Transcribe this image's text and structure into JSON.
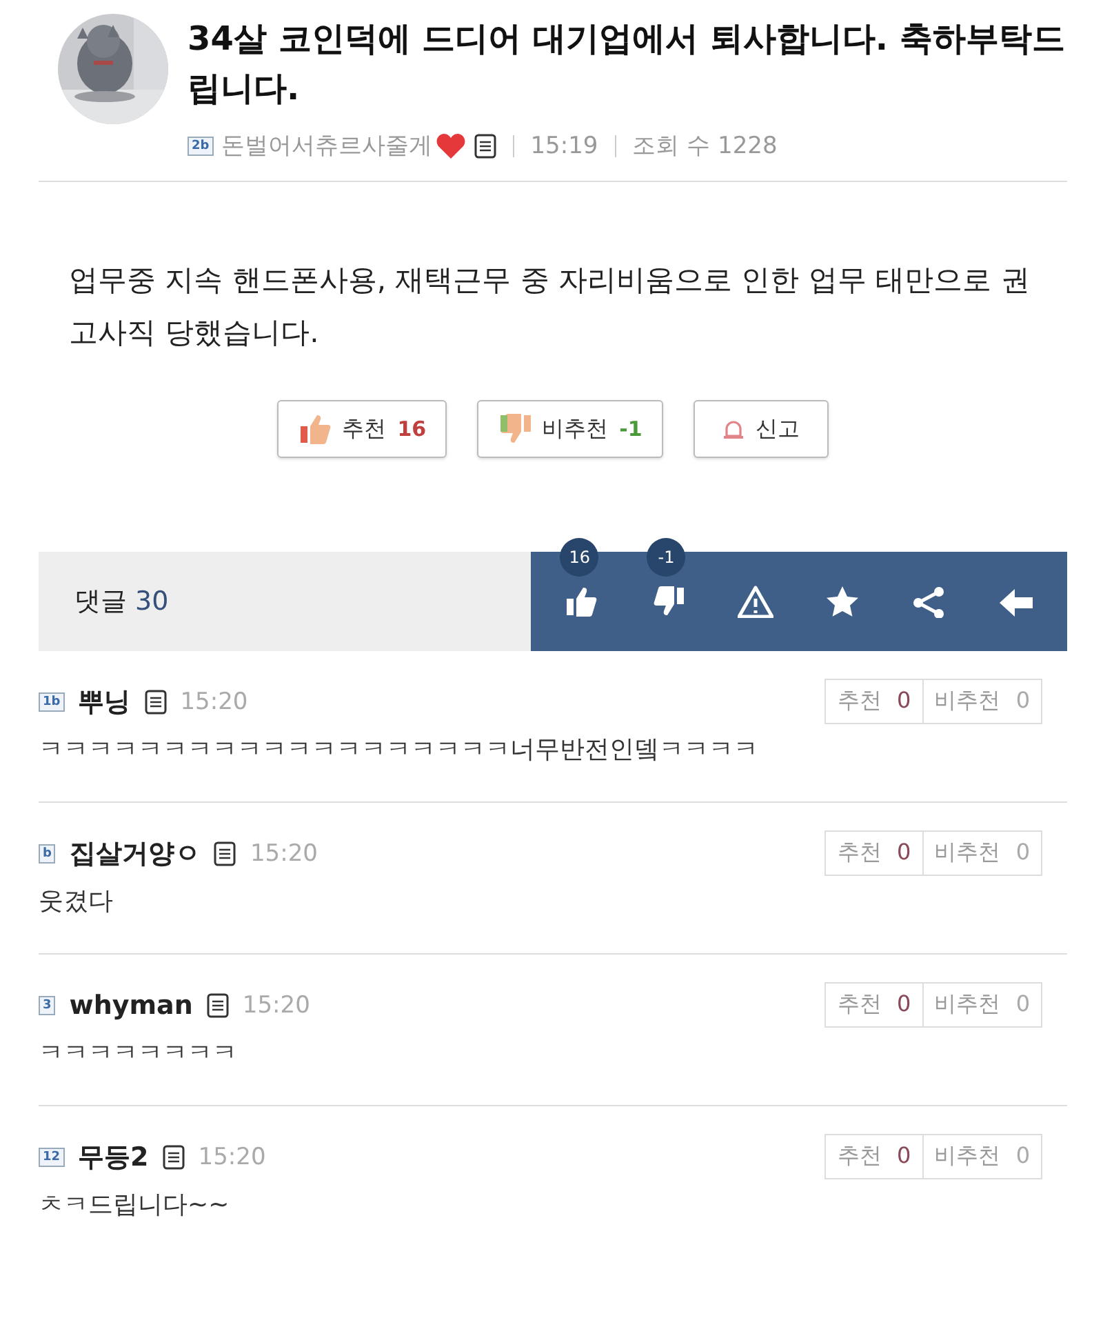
{
  "post": {
    "title": "34살 코인덕에 드디어 대기업에서 퇴사합니다. 축하부탁드립니다.",
    "author_level": "2b",
    "author": "돈벌어서츄르사줄게",
    "time": "15:19",
    "views_label": "조회 수",
    "views": "1228",
    "body": "업무중 지속 핸드폰사용, 재택근무 중 자리비움으로 인한 업무 태만으로 권고사직 당했습니다."
  },
  "vote_buttons": [
    {
      "kind": "up",
      "label": "추천",
      "count": "16"
    },
    {
      "kind": "down",
      "label": "비추천",
      "count": "-1"
    },
    {
      "kind": "report",
      "label": "신고"
    }
  ],
  "comment_bar": {
    "label": "댓글",
    "count": "30",
    "tools": [
      {
        "kind": "up",
        "badge": "16"
      },
      {
        "kind": "down",
        "badge": "-1"
      },
      {
        "kind": "warn"
      },
      {
        "kind": "star"
      },
      {
        "kind": "share"
      },
      {
        "kind": "back"
      }
    ]
  },
  "comments": [
    {
      "level": "1b",
      "name": "뿌닝",
      "time": "15:20",
      "text": "ㅋㅋㅋㅋㅋㅋㅋㅋㅋㅋㅋㅋㅋㅋㅋㅋㅋㅋㅋ너무반전인뎈ㅋㅋㅋㅋ",
      "up_label": "추천",
      "up": "0",
      "down_label": "비추천",
      "down": "0"
    },
    {
      "level": "b",
      "name": "집살거양ㅇ",
      "time": "15:20",
      "text": "웃겼다",
      "up_label": "추천",
      "up": "0",
      "down_label": "비추천",
      "down": "0"
    },
    {
      "level": "3",
      "name": "whyman",
      "time": "15:20",
      "text": "ㅋㅋㅋㅋㅋㅋㅋㅋ",
      "up_label": "추천",
      "up": "0",
      "down_label": "비추천",
      "down": "0"
    },
    {
      "level": "12",
      "name": "무등2",
      "time": "15:20",
      "text": "ㅊㅋ드립니다~~",
      "up_label": "추천",
      "up": "0",
      "down_label": "비추천",
      "down": "0"
    }
  ]
}
